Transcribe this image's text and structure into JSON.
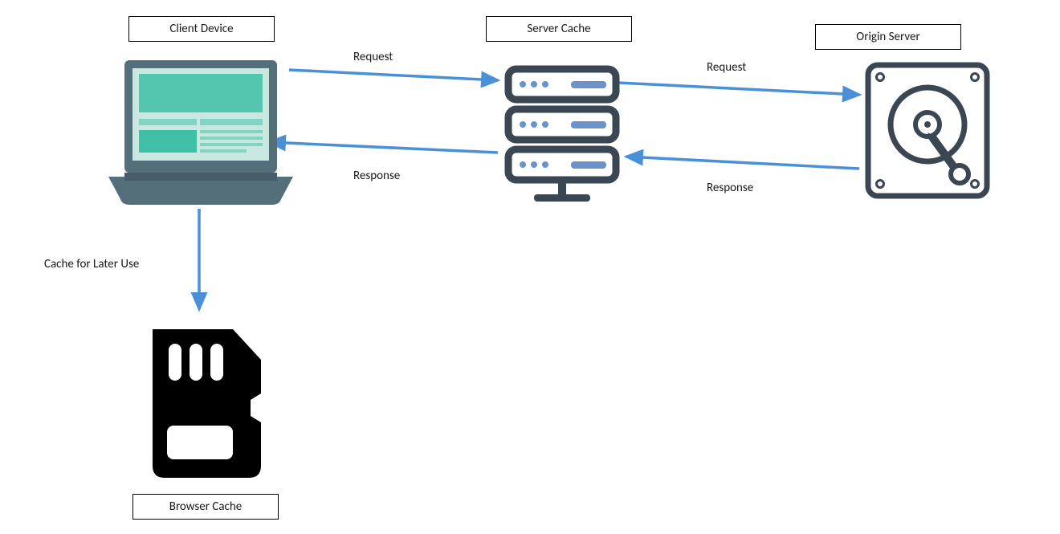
{
  "nodes": {
    "client": {
      "label": "Client Device"
    },
    "server_cache": {
      "label": "Server Cache"
    },
    "origin": {
      "label": "Origin Server"
    },
    "browser_cache": {
      "label": "Browser Cache"
    }
  },
  "edges": {
    "client_to_server_cache": {
      "label": "Request"
    },
    "server_cache_to_origin": {
      "label": "Request"
    },
    "origin_to_server_cache": {
      "label": "Response"
    },
    "server_cache_to_client": {
      "label": "Response"
    },
    "client_to_browser_cache": {
      "label": "Cache for Later Use"
    }
  },
  "colors": {
    "arrow": "#4A90D9",
    "laptop_body": "#546E7A",
    "laptop_screen_bg": "#c9e8e0",
    "laptop_teal": "#3fbfa5",
    "server_body": "#3a4752",
    "server_accent": "#6b92c9",
    "hdd": "#3a4752",
    "sd": "#000000"
  }
}
